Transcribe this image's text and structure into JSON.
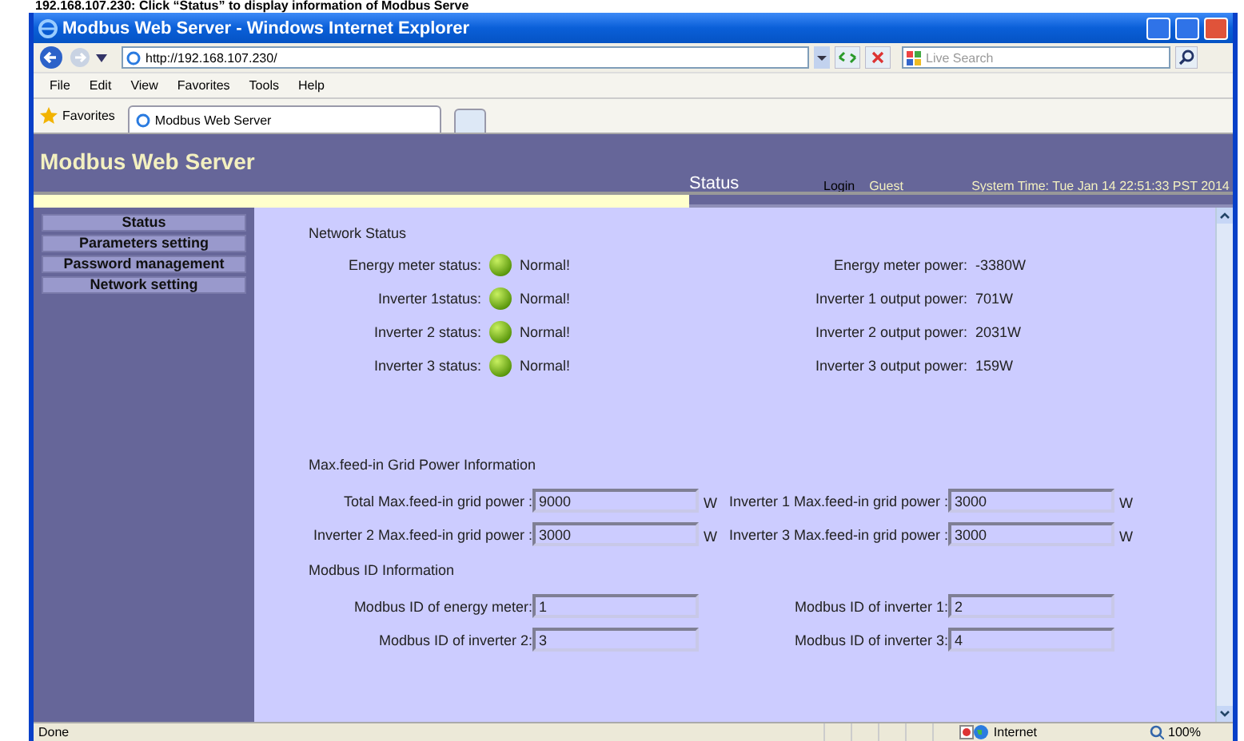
{
  "caption": "192.168.107.230: Click “Status” to display information of Modbus Serve",
  "window": {
    "title": "Modbus Web Server - Windows Internet Explorer"
  },
  "address_bar": {
    "value": "http://192.168.107.230/"
  },
  "search": {
    "placeholder": "Live Search"
  },
  "menu": [
    "File",
    "Edit",
    "View",
    "Favorites",
    "Tools",
    "Help"
  ],
  "favorites_button": "Favorites",
  "tabs": [
    {
      "label": "Modbus Web Server",
      "selected": true
    }
  ],
  "site": {
    "title": "Modbus Web Server",
    "page_title": "Status",
    "login": "Login",
    "user": "Guest",
    "system_time": "System Time: Tue Jan 14 22:51:33 PST 2014"
  },
  "sidebar": {
    "items": [
      "Status",
      "Parameters setting",
      "Password management",
      "Network setting"
    ]
  },
  "network_status": {
    "heading": "Network Status",
    "statuses": [
      {
        "label": "Energy meter status:",
        "value": "Normal!"
      },
      {
        "label": "Inverter 1status:",
        "value": "Normal!"
      },
      {
        "label": "Inverter 2 status:",
        "value": "Normal!"
      },
      {
        "label": "Inverter 3 status:",
        "value": "Normal!"
      }
    ],
    "powers": [
      {
        "label": "Energy meter power:",
        "value": "-3380W"
      },
      {
        "label": "Inverter 1 output power:",
        "value": "701W"
      },
      {
        "label": "Inverter 2 output power:",
        "value": "2031W"
      },
      {
        "label": "Inverter 3 output power:",
        "value": "159W"
      }
    ]
  },
  "max_feed_in": {
    "heading": "Max.feed-in Grid Power Information",
    "fields": [
      {
        "label": "Total Max.feed-in grid power :",
        "value": "9000",
        "unit": "W"
      },
      {
        "label": "Inverter 1 Max.feed-in grid power :",
        "value": "3000",
        "unit": "W"
      },
      {
        "label": "Inverter 2 Max.feed-in grid power :",
        "value": "3000",
        "unit": "W"
      },
      {
        "label": "Inverter 3 Max.feed-in grid power :",
        "value": "3000",
        "unit": "W"
      }
    ]
  },
  "modbus_id": {
    "heading": "Modbus ID Information",
    "fields": [
      {
        "label": "Modbus ID of energy meter:",
        "value": "1"
      },
      {
        "label": "Modbus ID of inverter 1:",
        "value": "2"
      },
      {
        "label": "Modbus ID of inverter 2:",
        "value": "3"
      },
      {
        "label": "Modbus ID of inverter 3:",
        "value": "4"
      }
    ]
  },
  "status_bar": {
    "text": "Done",
    "zone": "Internet",
    "zoom": "100%"
  }
}
